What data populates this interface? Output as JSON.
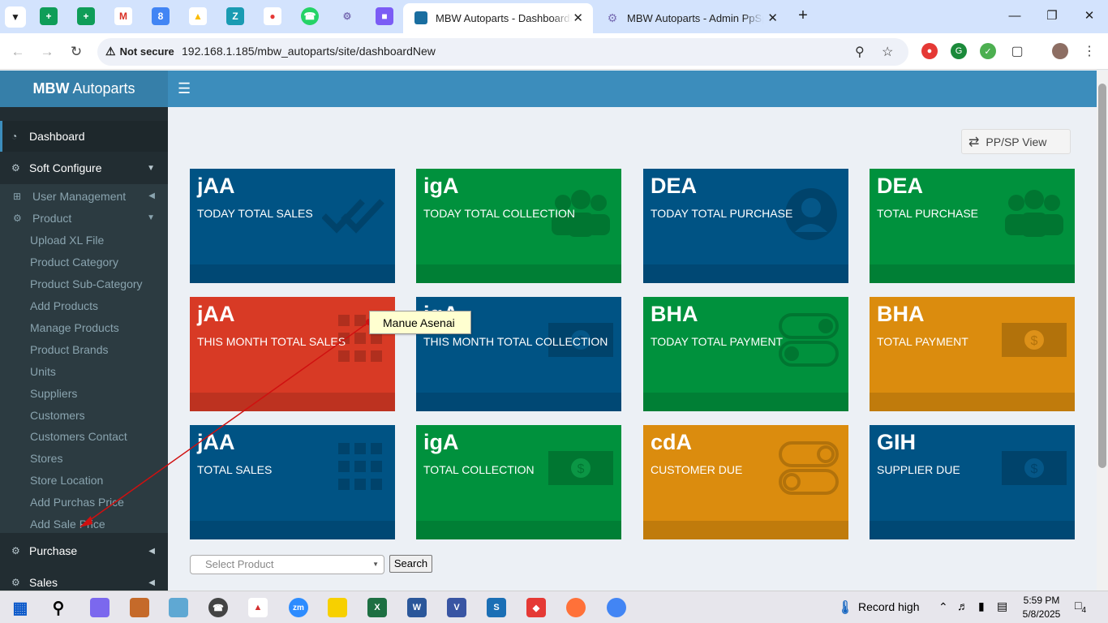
{
  "browser": {
    "tabs": [
      {
        "title": "MBW Autoparts - DashboardNew",
        "active": true
      },
      {
        "title": "MBW Autoparts - Admin PpSpSale",
        "active": false
      }
    ],
    "address": {
      "security_label": "Not secure",
      "url": "192.168.1.185/mbw_autoparts/site/dashboardNew"
    }
  },
  "app": {
    "brand_bold": "MBW",
    "brand_rest": " Autoparts",
    "sidebar": {
      "dashboard": "Dashboard",
      "soft_configure": "Soft Configure",
      "user_management": "User Management",
      "product": "Product",
      "product_items": [
        "Upload XL File",
        "Product Category",
        "Product Sub-Category",
        "Add Products",
        "Manage Products",
        "Product Brands",
        "Units",
        "Suppliers",
        "Customers",
        "Customers Contact",
        "Stores",
        "Store Location",
        "Add Purchas Price",
        "Add Sale Price"
      ],
      "purchase": "Purchase",
      "sales": "Sales"
    },
    "ppsp_button": "PP/SP View",
    "boxes": [
      {
        "value": "jAA",
        "label": "TODAY TOTAL SALES",
        "color": "#005384",
        "icon": "checkmark-icon"
      },
      {
        "value": "igA",
        "label": "TODAY TOTAL COLLECTION",
        "color": "#00913d",
        "icon": "users-icon"
      },
      {
        "value": "DEA",
        "label": "TODAY TOTAL PURCHASE",
        "color": "#005384",
        "icon": "user-icon"
      },
      {
        "value": "DEA",
        "label": "TOTAL PURCHASE",
        "color": "#00913d",
        "icon": "users-icon"
      },
      {
        "value": "jAA",
        "label": "THIS MONTH TOTAL SALES",
        "color": "#d83a25",
        "icon": "grid-icon"
      },
      {
        "value": "igA",
        "label": "THIS MONTH TOTAL COLLECTION",
        "color": "#005384",
        "icon": "money-icon"
      },
      {
        "value": "BHA",
        "label": "TODAY TOTAL PAYMENT",
        "color": "#00913d",
        "icon": "toggle-icon"
      },
      {
        "value": "BHA",
        "label": "TOTAL PAYMENT",
        "color": "#db8c0e",
        "icon": "money-icon"
      },
      {
        "value": "jAA",
        "label": "TOTAL SALES",
        "color": "#005384",
        "icon": "grid-icon"
      },
      {
        "value": "igA",
        "label": "TOTAL COLLECTION",
        "color": "#00913d",
        "icon": "money-icon"
      },
      {
        "value": "cdA",
        "label": "CUSTOMER DUE",
        "color": "#db8c0e",
        "icon": "toggle-icon"
      },
      {
        "value": "GIH",
        "label": "SUPPLIER DUE",
        "color": "#005384",
        "icon": "money-icon"
      }
    ],
    "product_select_placeholder": "Select Product",
    "search_button": "Search",
    "annotation": "Manue Asenai"
  },
  "taskbar": {
    "weather": "Record high",
    "time": "5:59 PM",
    "date": "5/8/2025",
    "notifications": "4"
  }
}
